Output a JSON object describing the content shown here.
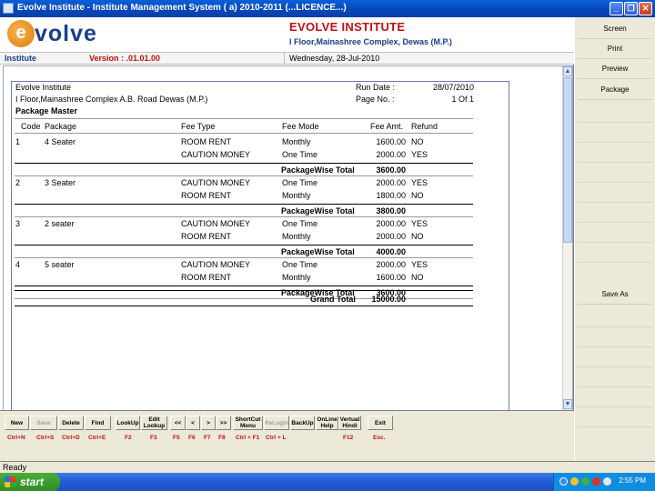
{
  "window": {
    "title": "Evolve Institute - Institute Management System ( a) 2010-2011 (...LICENCE...)",
    "buttons": [
      "_",
      "❐",
      "✕"
    ]
  },
  "header": {
    "logo_initial": "e",
    "logo_text": "volve",
    "institute_name": "EVOLVE INSTITUTE",
    "address": "I Floor,Mainashree Complex, Dewas (M.P.)"
  },
  "infobar": {
    "module": "Institute",
    "version": "Version : .01.01.00",
    "date": "Wednesday, 28-Jul-2010"
  },
  "report": {
    "org": "Evolve Institute",
    "address": "I Floor,Mainashree Complex A.B. Road Dewas (M.P.)",
    "title": "Package Master",
    "run_date_label": "Run Date :",
    "run_date": "28/07/2010",
    "page_label": "Page No. :",
    "page_value": "1 Of 1",
    "columns": [
      "Code",
      "Package",
      "Fee Type",
      "Fee Mode",
      "Fee Amt.",
      "Refund"
    ],
    "groups": [
      {
        "code": "1",
        "package": "4 Seater",
        "rows": [
          {
            "fee_type": "ROOM RENT",
            "fee_mode": "Monthly",
            "amount": "1600.00",
            "refund": "NO"
          },
          {
            "fee_type": "CAUTION MONEY",
            "fee_mode": "One Time",
            "amount": "2000.00",
            "refund": "YES"
          }
        ],
        "total_label": "PackageWise Total",
        "total": "3600.00"
      },
      {
        "code": "2",
        "package": "3 Seater",
        "rows": [
          {
            "fee_type": "CAUTION MONEY",
            "fee_mode": "One Time",
            "amount": "2000.00",
            "refund": "YES"
          },
          {
            "fee_type": "ROOM RENT",
            "fee_mode": "Monthly",
            "amount": "1800.00",
            "refund": "NO"
          }
        ],
        "total_label": "PackageWise Total",
        "total": "3800.00"
      },
      {
        "code": "3",
        "package": "2 seater",
        "rows": [
          {
            "fee_type": "CAUTION MONEY",
            "fee_mode": "One Time",
            "amount": "2000.00",
            "refund": "YES"
          },
          {
            "fee_type": "ROOM RENT",
            "fee_mode": "Monthly",
            "amount": "2000.00",
            "refund": "NO"
          }
        ],
        "total_label": "PackageWise Total",
        "total": "4000.00"
      },
      {
        "code": "4",
        "package": "5 seater",
        "rows": [
          {
            "fee_type": "CAUTION MONEY",
            "fee_mode": "One Time",
            "amount": "2000.00",
            "refund": "YES"
          },
          {
            "fee_type": "ROOM RENT",
            "fee_mode": "Monthly",
            "amount": "1600.00",
            "refund": "NO"
          }
        ],
        "total_label": "PackageWise Total",
        "total": "3600.00"
      }
    ],
    "grand_total_label": "Grand Total",
    "grand_total": "15000.00"
  },
  "toolbar": {
    "buttons": [
      {
        "name": "new",
        "label": "New",
        "shortcut": "Ctrl+N",
        "enabled": true
      },
      {
        "name": "save",
        "label": "Save",
        "shortcut": "Ctrl+S",
        "enabled": false
      },
      {
        "name": "delete",
        "label": "Delete",
        "shortcut": "Ctrl+D",
        "enabled": true
      },
      {
        "name": "find",
        "label": "Find",
        "shortcut": "Ctrl+E",
        "enabled": true
      },
      {
        "name": "lookup",
        "label": "LookUp",
        "shortcut": "F2",
        "enabled": true
      },
      {
        "name": "edit-lookup",
        "label": "Edit Lookup",
        "shortcut": "F3",
        "enabled": true
      },
      {
        "name": "first",
        "label": "<<",
        "shortcut": "F5",
        "enabled": true
      },
      {
        "name": "prev",
        "label": "<",
        "shortcut": "F6",
        "enabled": true
      },
      {
        "name": "next",
        "label": ">",
        "shortcut": "F7",
        "enabled": true
      },
      {
        "name": "last",
        "label": ">>",
        "shortcut": "F8",
        "enabled": true
      },
      {
        "name": "shortcut-menu",
        "label": "ShortCut Menu",
        "shortcut": "Ctrl + F1",
        "enabled": true
      },
      {
        "name": "relogin",
        "label": "ReLogin",
        "shortcut": "Ctrl + L",
        "enabled": false
      },
      {
        "name": "backup",
        "label": "BackUp",
        "shortcut": "",
        "enabled": true
      },
      {
        "name": "online-help",
        "label": "OnLine Help",
        "shortcut": "",
        "enabled": true
      },
      {
        "name": "virtual-hindi",
        "label": "Vertual Hindi",
        "shortcut": "F12",
        "enabled": true
      },
      {
        "name": "exit",
        "label": "Exit",
        "shortcut": "Esc.",
        "enabled": true
      }
    ]
  },
  "right_panel": {
    "screen": "Screen",
    "print": "Print",
    "preview": "Preview",
    "package": "Package",
    "save_as": "Save As"
  },
  "status": "Ready",
  "taskbar": {
    "start": "start",
    "clock": "2:55 PM"
  }
}
